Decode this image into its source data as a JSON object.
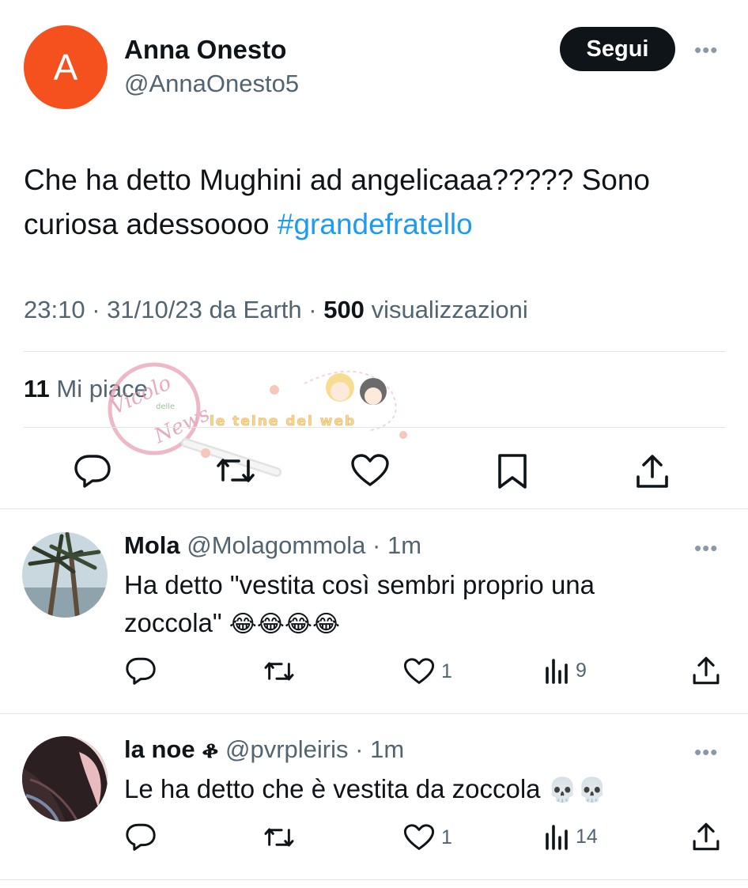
{
  "tweet": {
    "avatar_letter": "A",
    "avatar_color": "#f4511e",
    "author_name": "Anna Onesto",
    "author_handle": "@AnnaOnesto5",
    "follow_label": "Segui",
    "more_label": "•••",
    "text": "Che ha detto Mughini ad angelicaaa????? Sono curiosa adessoooo ",
    "hashtag": "#grandefratello",
    "time": "23:10",
    "date": "31/10/23",
    "source": "da Earth",
    "views_count": "500",
    "views_label": "visualizzazioni",
    "likes_count": "11",
    "likes_label": "Mi piace",
    "actions": [
      "reply-icon",
      "retweet-icon",
      "like-icon",
      "bookmark-icon",
      "share-icon"
    ]
  },
  "watermark": {
    "script_text": "Vicolo",
    "small_text": "delle",
    "script_text2": "News",
    "banner_text": "le teine dei web"
  },
  "replies": [
    {
      "name": "Mola",
      "handle": "@Molagommola",
      "time": "1m",
      "text_line1": "Ha detto \"vestita così sembri proprio una",
      "text_line2": "zoccola\"",
      "emojis": "😂😂😂😂",
      "likes": "1",
      "views": "9",
      "more_label": "•••"
    },
    {
      "name": "la noe ቆ",
      "handle": "@pvrpleiris",
      "time": "1m",
      "text_line1": "Le ha detto che è vestita da zoccola",
      "emojis": "💀💀",
      "likes": "1",
      "views": "14",
      "more_label": "•••"
    }
  ],
  "colors": {
    "accent": "#1d9bf0",
    "text": "#0f1419",
    "secondary": "#536471",
    "button_bg": "#0f1419"
  }
}
